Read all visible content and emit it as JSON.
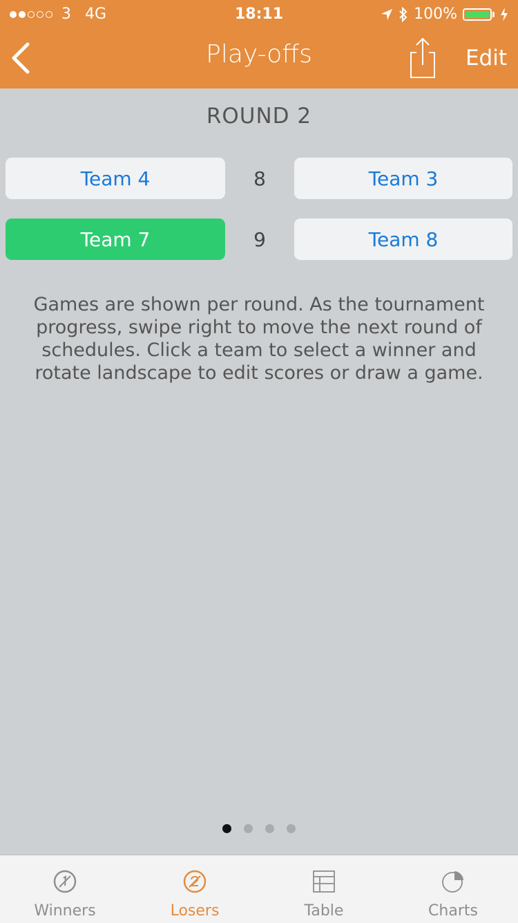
{
  "status_bar": {
    "carrier": "3",
    "network": "4G",
    "time": "18:11",
    "battery": "100%"
  },
  "nav": {
    "title": "Play-offs",
    "edit_label": "Edit"
  },
  "round": {
    "title": "ROUND 2",
    "matches": [
      {
        "left_team": "Team 4",
        "score": "8",
        "right_team": "Team 3",
        "winner": "none"
      },
      {
        "left_team": "Team 7",
        "score": "9",
        "right_team": "Team 8",
        "winner": "left"
      }
    ]
  },
  "info_text": "Games are shown per round. As the tournament progress, swipe right to move the next round of schedules. Click a team to select a winner and rotate landscape to edit scores or draw a game.",
  "pagination": {
    "pages": 4,
    "current": 1
  },
  "tabs": [
    {
      "label": "Winners",
      "icon": "winners-badge-icon",
      "active": false
    },
    {
      "label": "Losers",
      "icon": "losers-badge-icon",
      "active": true
    },
    {
      "label": "Table",
      "icon": "table-icon",
      "active": false
    },
    {
      "label": "Charts",
      "icon": "pie-chart-icon",
      "active": false
    }
  ],
  "colors": {
    "accent": "#e58c3e",
    "winner": "#2ecc71",
    "team_text": "#1a7ad8",
    "background": "#cdd0d2",
    "battery": "#4cd964"
  }
}
